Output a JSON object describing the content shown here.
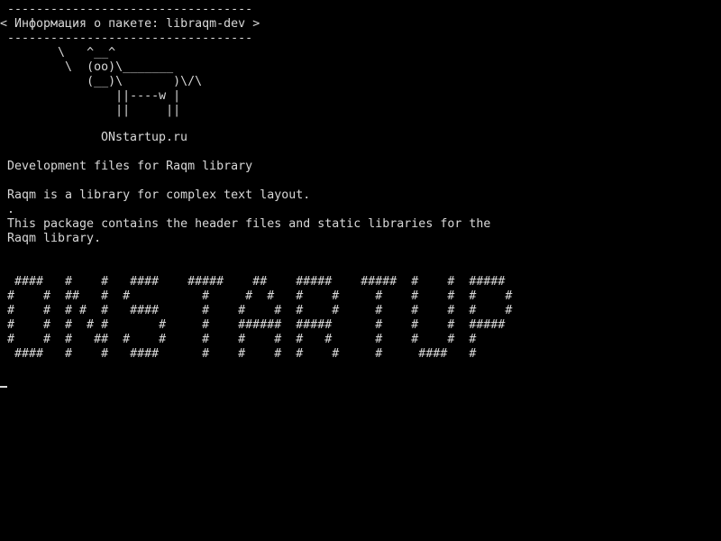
{
  "terminal": {
    "background": "#000000",
    "foreground": "#d8d8d8",
    "cowsay": {
      "lines": [
        " ----------------------------------",
        "< Информация о пакете: libraqm-dev >",
        " ----------------------------------",
        "        \\   ^__^",
        "         \\  (oo)\\_______",
        "            (__)\\       )\\/\\",
        "                ||----w |",
        "                ||     ||"
      ]
    },
    "website": "ONstartup.ru",
    "package_summary": "Development files for Raqm library",
    "description_lines": [
      "Raqm is a library for complex text layout.",
      ".",
      "This package contains the header files and static libraries for the",
      "Raqm library."
    ],
    "banner_lines": [
      " ####   #    #   ####    #####    ##    #####    #####  #    #  #####",
      "#    #  ##   #  #          #     #  #   #    #     #    #    #  #    #",
      "#    #  # #  #   ####      #    #    #  #    #     #    #    #  #    #",
      "#    #  #  # #       #     #    ######  #####      #    #    #  #####",
      "#    #  #   ##  #    #     #    #    #  #   #      #    #    #  #",
      " ####   #    #   ####      #    #    #  #    #     #     ####   #"
    ]
  }
}
